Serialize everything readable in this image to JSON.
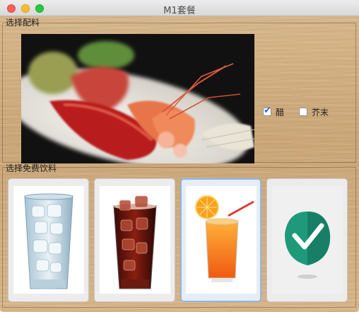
{
  "window": {
    "title": "M1套餐"
  },
  "seasoning": {
    "group_label": "选择配料",
    "options": [
      {
        "label": "醋",
        "checked": true
      },
      {
        "label": "芥末",
        "checked": false
      }
    ]
  },
  "drinks": {
    "group_label": "选择免费饮料",
    "selected_index": 2
  }
}
